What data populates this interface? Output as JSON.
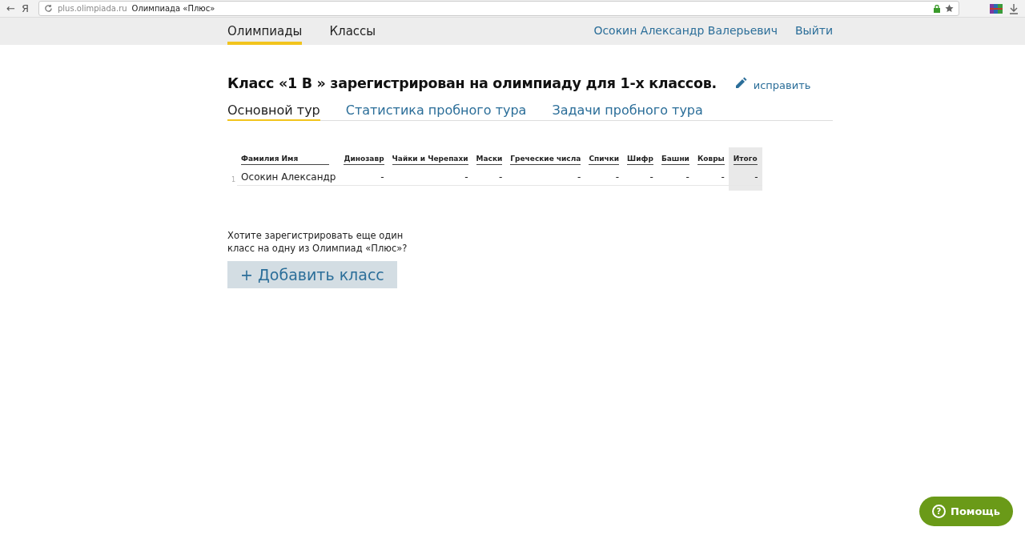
{
  "browser": {
    "back": "←",
    "yandex": "Я",
    "url": "plus.olimpiada.ru",
    "page_title": "Олимпиада «Плюс»"
  },
  "nav": {
    "items": [
      {
        "label": "Олимпиады",
        "selected": true
      },
      {
        "label": "Классы",
        "selected": false
      }
    ],
    "user": "Осокин Александр Валерьевич",
    "logout": "Выйти"
  },
  "heading": "Класс «1 В » зарегистрирован на олимпиаду для 1-х классов.",
  "edit_link": "исправить",
  "tabs": [
    {
      "label": "Основной тур",
      "selected": true
    },
    {
      "label": "Статистика пробного тура",
      "selected": false
    },
    {
      "label": "Задачи пробного тура",
      "selected": false
    }
  ],
  "table": {
    "columns": [
      {
        "label": "Фамилия Имя",
        "kind": "name"
      },
      {
        "label": "Динозавр",
        "kind": "task"
      },
      {
        "label": "Чайки и Черепахи",
        "kind": "task"
      },
      {
        "label": "Маски",
        "kind": "task"
      },
      {
        "label": "Греческие числа",
        "kind": "task"
      },
      {
        "label": "Спички",
        "kind": "task"
      },
      {
        "label": "Шифр",
        "kind": "task"
      },
      {
        "label": "Башни",
        "kind": "task"
      },
      {
        "label": "Ковры",
        "kind": "task"
      },
      {
        "label": "Итого",
        "kind": "total"
      }
    ],
    "rows": [
      {
        "number": "1",
        "cells": [
          "Осокин Александр",
          "-",
          "-",
          "-",
          "-",
          "-",
          "-",
          "-",
          "-",
          "-"
        ]
      }
    ]
  },
  "prompt": "Хотите зарегистрировать еще один класс на одну из Олимпиад «Плюс»?",
  "add_button": "+ Добавить класс",
  "help_button": "Помощь",
  "help_icon": "?"
}
